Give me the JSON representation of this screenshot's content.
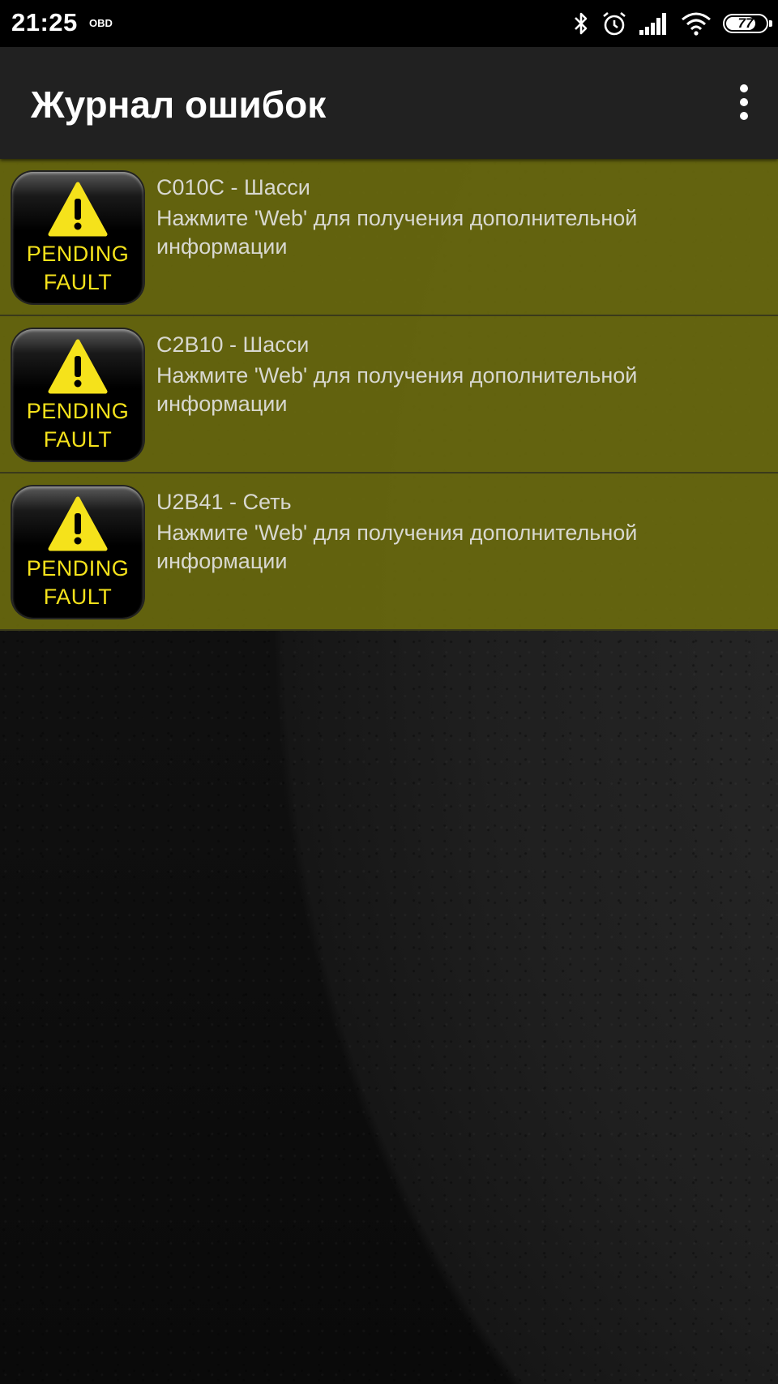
{
  "status_bar": {
    "time": "21:25",
    "carrier_badge": "OBD",
    "battery_level": "77",
    "battery_fraction": 0.77,
    "icons": [
      "bluetooth-icon",
      "alarm-icon",
      "signal-icon",
      "wifi-icon",
      "battery-icon"
    ]
  },
  "app_bar": {
    "title": "Журнал ошибок",
    "menu_icon": "more-vert-icon"
  },
  "colors": {
    "row_background": "#68680e",
    "badge_text": "#f5e21b",
    "warning_triangle": "#f5e21b"
  },
  "faults": [
    {
      "code": "C010C - Шасси",
      "description": "Нажмите 'Web' для получения дополнительной информации",
      "badge_line1": "PENDING",
      "badge_line2": "FAULT"
    },
    {
      "code": "C2B10 - Шасси",
      "description": "Нажмите 'Web' для получения дополнительной информации",
      "badge_line1": "PENDING",
      "badge_line2": "FAULT"
    },
    {
      "code": "U2B41 - Сеть",
      "description": "Нажмите 'Web' для получения дополнительной информации",
      "badge_line1": "PENDING",
      "badge_line2": "FAULT"
    }
  ]
}
